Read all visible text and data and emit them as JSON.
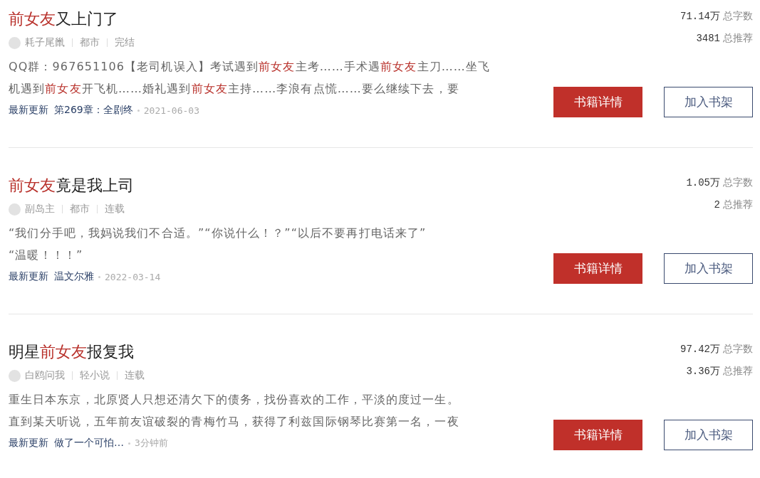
{
  "books": [
    {
      "title": [
        {
          "text": "前女友",
          "highlight": true
        },
        {
          "text": "又上门了",
          "highlight": false
        }
      ],
      "author": "耗子尾巤",
      "category": "都市",
      "status": "完结",
      "description": [
        [
          {
            "text": "QQ群：967651106【老司机误入】考试遇到",
            "highlight": false
          },
          {
            "text": "前女友",
            "highlight": true
          },
          {
            "text": "主考……手术遇",
            "highlight": false
          },
          {
            "text": "前女友",
            "highlight": true
          },
          {
            "text": "主刀……坐飞",
            "highlight": false
          }
        ],
        [
          {
            "text": "机遇到",
            "highlight": false
          },
          {
            "text": "前女友",
            "highlight": true
          },
          {
            "text": "开飞机……婚礼遇到",
            "highlight": false
          },
          {
            "text": "前女友",
            "highlight": true
          },
          {
            "text": "主持……李浪有点慌……要么继续下去，要",
            "highlight": false
          }
        ]
      ],
      "latest_label": "最新更新",
      "latest_chapter": "第269章：全剧终",
      "updated": "2021-06-03",
      "stats": [
        {
          "value": "71.14万",
          "label": "总字数"
        },
        {
          "value": "3481",
          "label": "总推荐"
        }
      ],
      "buttons": [
        {
          "label": "书籍详情",
          "kind": "primary"
        },
        {
          "label": "加入书架",
          "kind": "secondary"
        }
      ]
    },
    {
      "title": [
        {
          "text": "前女友",
          "highlight": true
        },
        {
          "text": "竟是我上司",
          "highlight": false
        }
      ],
      "author": "副岛主",
      "category": "都市",
      "status": "连载",
      "description": [
        [
          {
            "text": "“我们分手吧，我妈说我们不合适。”“你说什么！？”“以后不要再打电话来了”",
            "highlight": false
          }
        ],
        [
          {
            "text": "“温暖！！！”",
            "highlight": false
          }
        ]
      ],
      "latest_label": "最新更新",
      "latest_chapter": "温文尔雅",
      "updated": "2022-03-14",
      "stats": [
        {
          "value": "1.05万",
          "label": "总字数"
        },
        {
          "value": "2",
          "label": "总推荐"
        }
      ],
      "buttons": [
        {
          "label": "书籍详情",
          "kind": "primary"
        },
        {
          "label": "加入书架",
          "kind": "secondary"
        }
      ]
    },
    {
      "title": [
        {
          "text": "明星",
          "highlight": false
        },
        {
          "text": "前女友",
          "highlight": true
        },
        {
          "text": "报复我",
          "highlight": false
        }
      ],
      "author": "白鸥问我",
      "category": "轻小说",
      "status": "连载",
      "description": [
        [
          {
            "text": "重生日本东京，北原贤人只想还清欠下的债务，找份喜欢的工作，平淡的度过一生。",
            "highlight": false
          }
        ],
        [
          {
            "text": "直到某天听说，五年前友谊破裂的青梅竹马，获得了利兹国际钢琴比赛第一名，一夜",
            "highlight": false
          }
        ]
      ],
      "latest_label": "最新更新",
      "latest_chapter": "做了一个可怕…",
      "updated": "3分钟前",
      "stats": [
        {
          "value": "97.42万",
          "label": "总字数"
        },
        {
          "value": "3.36万",
          "label": "总推荐"
        }
      ],
      "buttons": [
        {
          "label": "书籍详情",
          "kind": "primary"
        },
        {
          "label": "加入书架",
          "kind": "secondary"
        }
      ]
    }
  ]
}
